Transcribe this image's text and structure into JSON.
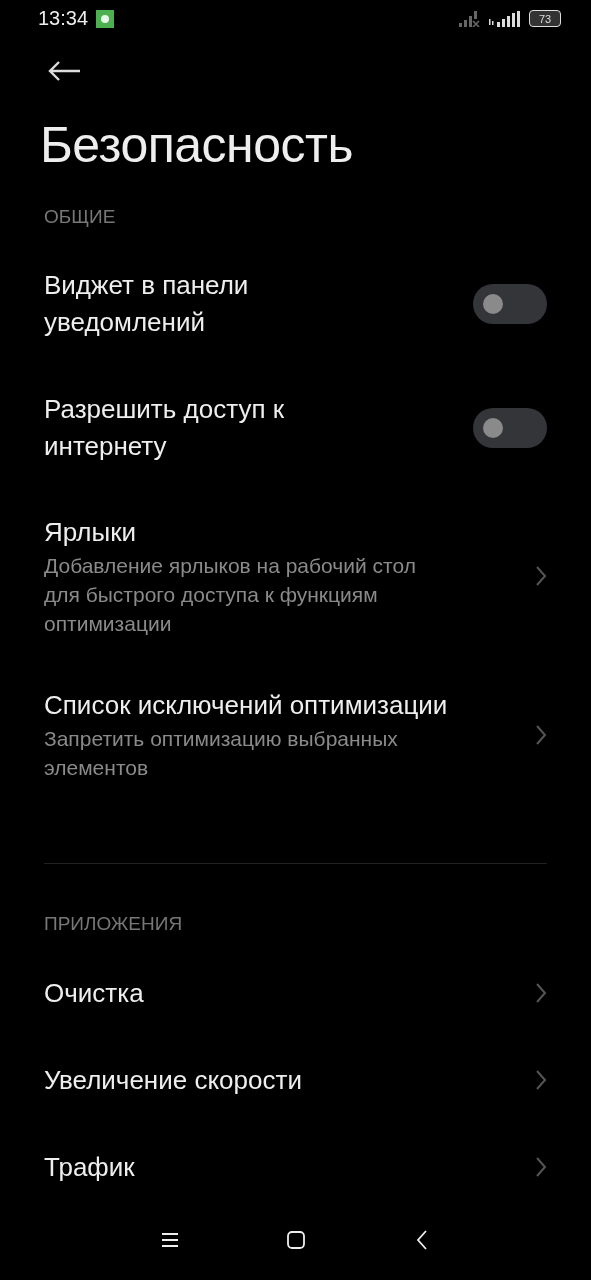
{
  "status_bar": {
    "time": "13:34",
    "battery": "73"
  },
  "title": "Безопасность",
  "sections": [
    {
      "header": "ОБЩИЕ",
      "items": [
        {
          "kind": "toggle",
          "title": "Виджет в панели уведомлений",
          "on": false
        },
        {
          "kind": "toggle",
          "title": "Разрешить доступ к интернету",
          "on": false
        },
        {
          "kind": "link",
          "title": "Ярлыки",
          "subtitle": "Добавление ярлыков на рабочий стол для быстрого доступа к функциям оптимизации"
        },
        {
          "kind": "link",
          "title": "Список исключений оптимизации",
          "subtitle": "Запретить оптимизацию выбранных элементов"
        }
      ]
    },
    {
      "header": "ПРИЛОЖЕНИЯ",
      "items": [
        {
          "kind": "link",
          "title": "Очистка"
        },
        {
          "kind": "link",
          "title": "Увеличение скорости"
        },
        {
          "kind": "link",
          "title": "Трафик"
        }
      ]
    }
  ]
}
